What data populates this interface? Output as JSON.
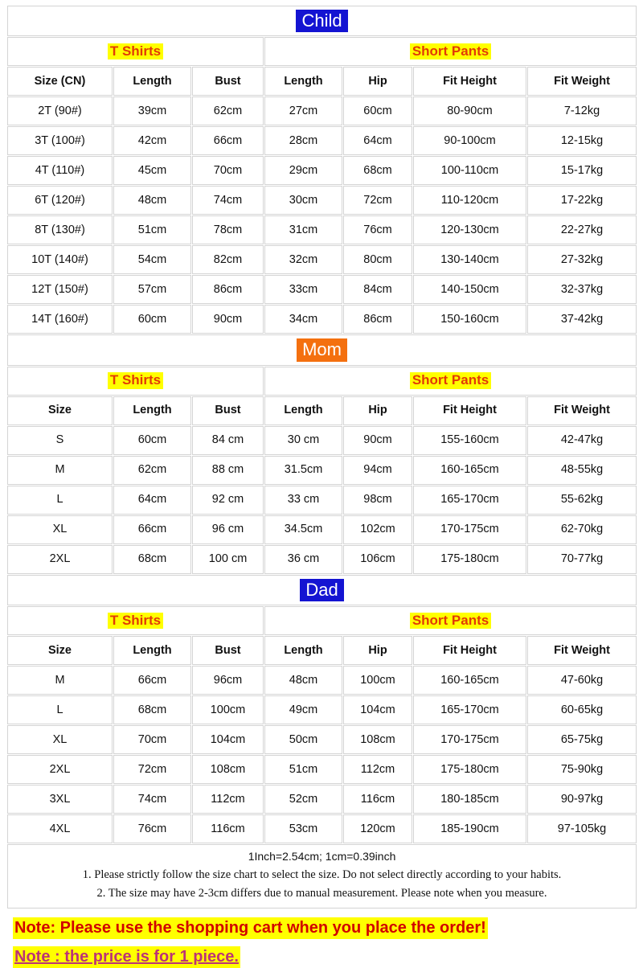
{
  "colors": {
    "badge_blue": "#1414d2",
    "badge_orange": "#f4700f",
    "highlight_yellow": "#ffff00",
    "section_text_red": "#e23a06",
    "note_red": "#d10000",
    "note_magenta": "#bb3377",
    "border_gray": "#d4d4d4"
  },
  "sections": [
    {
      "title": "Child",
      "title_style": "blue",
      "groups": {
        "left": "T Shirts",
        "right": "Short Pants"
      },
      "columns": [
        "Size (CN)",
        "Length",
        "Bust",
        "Length",
        "Hip",
        "Fit Height",
        "Fit Weight"
      ],
      "rows": [
        [
          "2T (90#)",
          "39cm",
          "62cm",
          "27cm",
          "60cm",
          "80-90cm",
          "7-12kg"
        ],
        [
          "3T (100#)",
          "42cm",
          "66cm",
          "28cm",
          "64cm",
          "90-100cm",
          "12-15kg"
        ],
        [
          "4T (110#)",
          "45cm",
          "70cm",
          "29cm",
          "68cm",
          "100-110cm",
          "15-17kg"
        ],
        [
          "6T  (120#)",
          "48cm",
          "74cm",
          "30cm",
          "72cm",
          "110-120cm",
          "17-22kg"
        ],
        [
          "8T (130#)",
          "51cm",
          "78cm",
          "31cm",
          "76cm",
          "120-130cm",
          "22-27kg"
        ],
        [
          "10T (140#)",
          "54cm",
          "82cm",
          "32cm",
          "80cm",
          "130-140cm",
          "27-32kg"
        ],
        [
          "12T (150#)",
          "57cm",
          "86cm",
          "33cm",
          "84cm",
          "140-150cm",
          "32-37kg"
        ],
        [
          "14T (160#)",
          "60cm",
          "90cm",
          "34cm",
          "86cm",
          "150-160cm",
          "37-42kg"
        ]
      ]
    },
    {
      "title": "Mom",
      "title_style": "orange",
      "groups": {
        "left": "T Shirts",
        "right": "Short Pants"
      },
      "columns": [
        "Size",
        "Length",
        "Bust",
        "Length",
        "Hip",
        "Fit Height",
        "Fit Weight"
      ],
      "rows": [
        [
          "S",
          "60cm",
          "84 cm",
          "30 cm",
          "90cm",
          "155-160cm",
          "42-47kg"
        ],
        [
          "M",
          "62cm",
          "88 cm",
          "31.5cm",
          "94cm",
          "160-165cm",
          "48-55kg"
        ],
        [
          "L",
          "64cm",
          "92 cm",
          "33 cm",
          "98cm",
          "165-170cm",
          "55-62kg"
        ],
        [
          "XL",
          "66cm",
          "96 cm",
          "34.5cm",
          "102cm",
          "170-175cm",
          "62-70kg"
        ],
        [
          "2XL",
          "68cm",
          "100 cm",
          "36 cm",
          "106cm",
          "175-180cm",
          "70-77kg"
        ]
      ]
    },
    {
      "title": "Dad",
      "title_style": "blue",
      "groups": {
        "left": "T Shirts",
        "right": "Short Pants"
      },
      "columns": [
        "Size",
        "Length",
        "Bust",
        "Length",
        "Hip",
        "Fit Height",
        "Fit Weight"
      ],
      "rows": [
        [
          "M",
          "66cm",
          "96cm",
          "48cm",
          "100cm",
          "160-165cm",
          "47-60kg"
        ],
        [
          "L",
          "68cm",
          "100cm",
          "49cm",
          "104cm",
          "165-170cm",
          "60-65kg"
        ],
        [
          "XL",
          "70cm",
          "104cm",
          "50cm",
          "108cm",
          "170-175cm",
          "65-75kg"
        ],
        [
          "2XL",
          "72cm",
          "108cm",
          "51cm",
          "112cm",
          "175-180cm",
          "75-90kg"
        ],
        [
          "3XL",
          "74cm",
          "112cm",
          "52cm",
          "116cm",
          "180-185cm",
          "90-97kg"
        ],
        [
          "4XL",
          "76cm",
          "116cm",
          "53cm",
          "120cm",
          "185-190cm",
          "97-105kg"
        ]
      ]
    }
  ],
  "footer": {
    "conversion": "1Inch=2.54cm; 1cm=0.39inch",
    "note_1": "1. Please strictly follow the size chart to select the size. Do not select directly according to your habits.",
    "note_2": "2. The size may have 2-3cm differs due to manual measurement. Please note when you measure."
  },
  "bottom_notes": {
    "note_cart": "Note: Please use the shopping cart when you place the order!",
    "note_price": "Note : the price is for 1 piece."
  }
}
